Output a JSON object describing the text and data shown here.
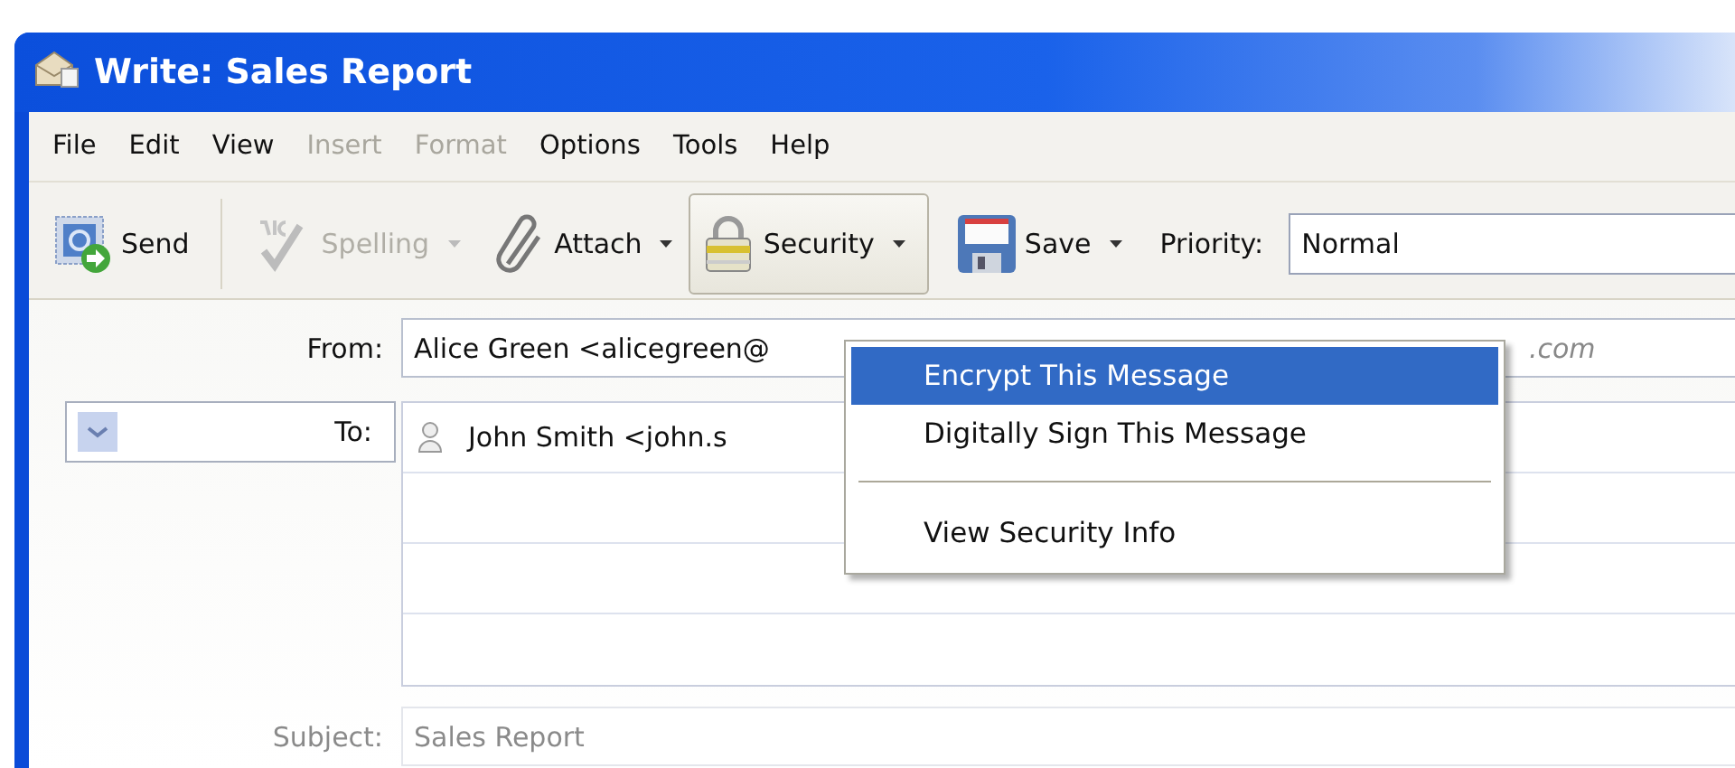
{
  "window": {
    "title": "Write: Sales Report"
  },
  "menu_bar": [
    {
      "label": "File",
      "disabled": false
    },
    {
      "label": "Edit",
      "disabled": false
    },
    {
      "label": "View",
      "disabled": false
    },
    {
      "label": "Insert",
      "disabled": true
    },
    {
      "label": "Format",
      "disabled": true
    },
    {
      "label": "Options",
      "disabled": false
    },
    {
      "label": "Tools",
      "disabled": false
    },
    {
      "label": "Help",
      "disabled": false
    }
  ],
  "toolbar": [
    {
      "kind": "send",
      "label": "Send",
      "disabled": false,
      "dropdown": false,
      "pressed": false
    },
    {
      "kind": "spelling",
      "label": "Spelling",
      "disabled": true,
      "dropdown": true,
      "pressed": false
    },
    {
      "kind": "attach",
      "label": "Attach",
      "disabled": false,
      "dropdown": true,
      "pressed": false
    },
    {
      "kind": "security",
      "label": "Security",
      "disabled": false,
      "dropdown": true,
      "pressed": true
    },
    {
      "kind": "save",
      "label": "Save",
      "disabled": false,
      "dropdown": true,
      "pressed": false
    }
  ],
  "priority": {
    "label": "Priority:",
    "value": "Normal"
  },
  "from": {
    "label": "From:",
    "value": "Alice Green <alicegreen@",
    "hint": ".com"
  },
  "recipients": [
    {
      "type": "To:",
      "value": "John Smith <john.s"
    }
  ],
  "subject": {
    "label": "Subject:",
    "value": "Sales Report"
  },
  "security_menu": [
    {
      "kind": "item",
      "label": "Encrypt This Message",
      "selected": true
    },
    {
      "kind": "item",
      "label": "Digitally Sign This Message",
      "selected": false
    },
    {
      "kind": "separator"
    },
    {
      "kind": "item",
      "label": "View Security Info",
      "selected": false
    }
  ]
}
